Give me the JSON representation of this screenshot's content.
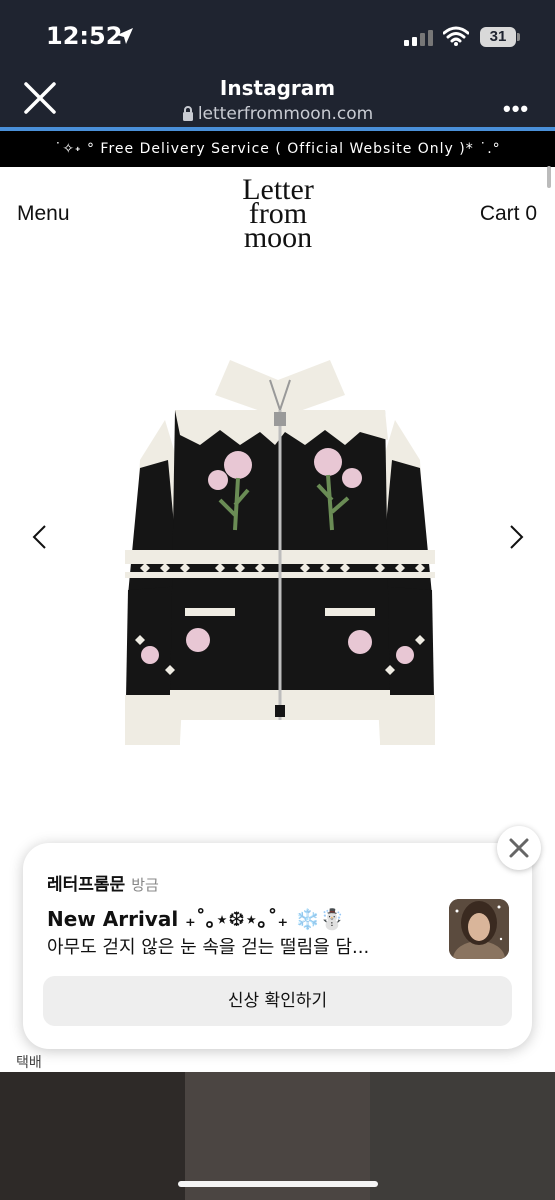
{
  "status_bar": {
    "time": "12:52",
    "battery": "31"
  },
  "browser": {
    "title": "Instagram",
    "url": "letterfrommoon.com",
    "more": "•••"
  },
  "site": {
    "banner": "˙✧˖ ° Free Delivery Service ( Official Website Only )* ˙.°",
    "menu_label": "Menu",
    "cart_label": "Cart 0",
    "logo_lines": [
      "Letter",
      "from",
      "moon"
    ]
  },
  "background_text": {
    "shipping": "택배"
  },
  "notification": {
    "sender": "레터프롬문",
    "time": "방금",
    "title": "New Arrival ₊˚｡⋆❆⋆｡˚₊ ❄️☃️",
    "body": "아무도 걷지 않은 눈 속을 걷는 떨림을 담...",
    "button": "신상 확인하기"
  }
}
